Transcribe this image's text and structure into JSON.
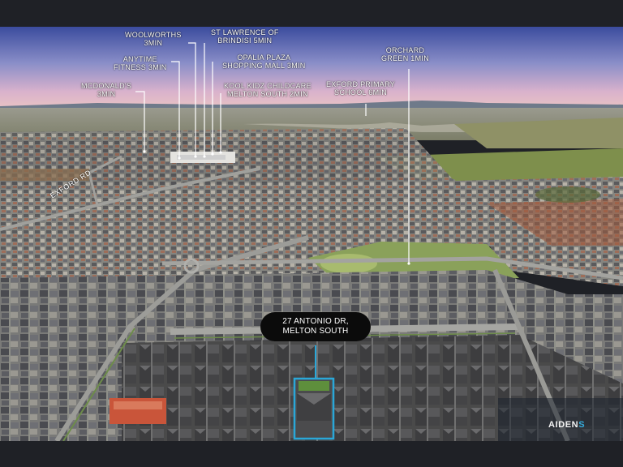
{
  "poi": [
    {
      "id": "woolworths",
      "line1": "WOOLWORTHS",
      "line2": "3MIN"
    },
    {
      "id": "st-lawrence",
      "line1": "ST LAWRENCE OF",
      "line2": "BRINDISI 5MIN"
    },
    {
      "id": "anytime-fitness",
      "line1": "ANYTIME",
      "line2": "FITNESS 3MIN"
    },
    {
      "id": "opalia-plaza",
      "line1": "OPALIA PLAZA",
      "line2": "SHOPPING MALL 3MIN"
    },
    {
      "id": "orchard-green",
      "line1": "ORCHARD",
      "line2": "GREEN 1MIN"
    },
    {
      "id": "mcdonalds",
      "line1": "MCDONALD'S",
      "line2": "3MIN"
    },
    {
      "id": "kool-kidz",
      "line1": "KOOL KIDZ CHILDCARE",
      "line2": "MELTON SOUTH 2MIN"
    },
    {
      "id": "exford-primary",
      "line1": "EXFORD PRIMARY",
      "line2": "SCHOOL 6MIN"
    }
  ],
  "road_label": "EXFORD RD",
  "address": {
    "line1": "27 ANTONIO DR,",
    "line2": "MELTON SOUTH"
  },
  "watermark": {
    "main": "AIDEN",
    "accent": "S"
  },
  "colors": {
    "highlight": "#2aa7d8",
    "badge": "#0b0b0b",
    "sky_top": "#3a4aa0",
    "sky_bottom": "#e0b0c8"
  }
}
